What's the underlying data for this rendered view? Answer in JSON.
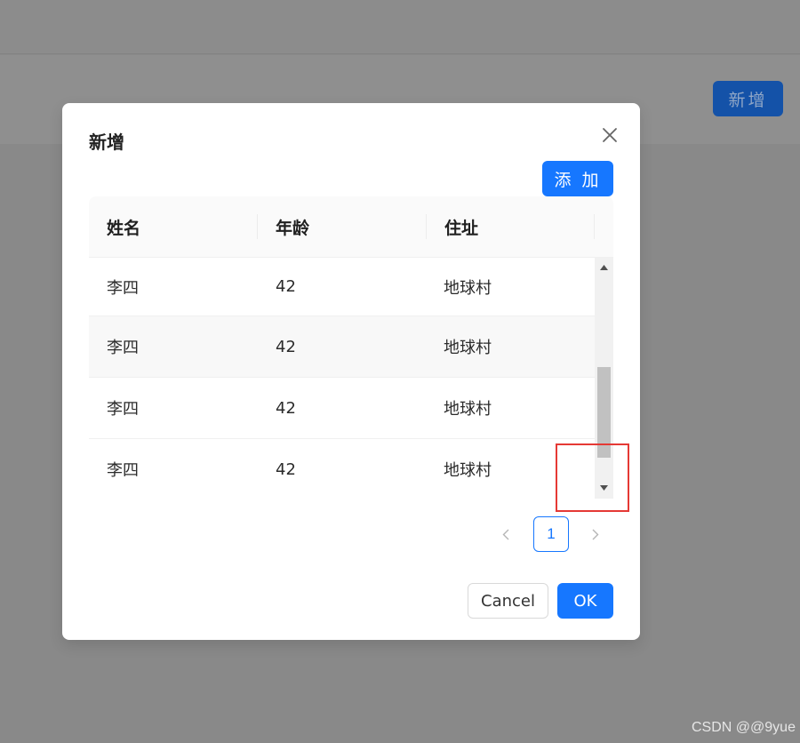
{
  "background": {
    "new_button_label": "新增"
  },
  "modal": {
    "title": "新增",
    "add_button_label": "添 加",
    "table": {
      "columns": [
        "姓名",
        "年龄",
        "住址"
      ],
      "rows": [
        {
          "name": "李四",
          "age": "42",
          "address": "地球村"
        },
        {
          "name": "李四",
          "age": "42",
          "address": "地球村"
        },
        {
          "name": "李四",
          "age": "42",
          "address": "地球村"
        },
        {
          "name": "李四",
          "age": "42",
          "address": "地球村"
        }
      ]
    },
    "pagination": {
      "current_page": "1"
    },
    "footer": {
      "cancel_label": "Cancel",
      "ok_label": "OK"
    }
  },
  "watermark": "CSDN @@9yue",
  "colors": {
    "primary": "#1677ff",
    "mask": "#8a8a8a",
    "highlight": "#e53935"
  },
  "icons": {
    "close": "close-icon",
    "scroll_up": "arrow-up-icon",
    "scroll_down": "arrow-down-icon",
    "prev": "chevron-left-icon",
    "next": "chevron-right-icon"
  }
}
